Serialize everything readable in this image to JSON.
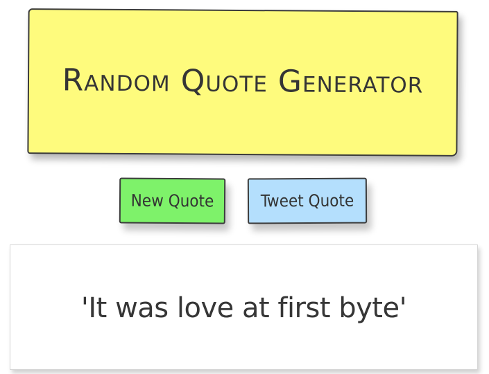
{
  "header": {
    "title": "Random Quote Generator"
  },
  "buttons": {
    "new_quote_label": "New Quote",
    "tweet_quote_label": "Tweet Quote"
  },
  "quote": {
    "text": "'It was love at first byte'"
  },
  "colors": {
    "title_background": "#fefb7d",
    "new_quote_background": "#7ef26a",
    "tweet_quote_background": "#b4dffd",
    "quote_background": "#ffffff",
    "border": "#3c3c3c"
  }
}
